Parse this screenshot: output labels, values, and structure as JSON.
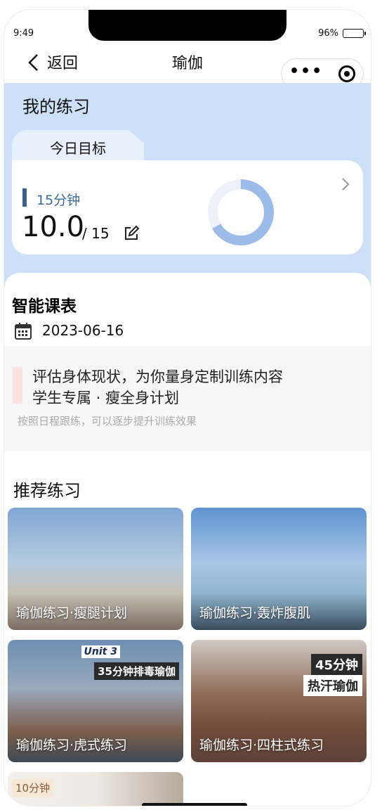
{
  "status_bar": {
    "time": "9:49",
    "battery": "96%"
  },
  "nav": {
    "back_label": "返回",
    "title": "瑜伽",
    "capsule_more": "•••"
  },
  "practice": {
    "title": "我的练习",
    "goal_tab": "今日目标",
    "duration": "15分钟",
    "value": "10.0",
    "total": "/ 15",
    "progress_fraction": 0.667,
    "colors": {
      "progress": "#9dbbe9",
      "track": "#edf1fa",
      "bar": "#3d5f8b"
    }
  },
  "schedule": {
    "title": "智能课表",
    "date": "2023-06-16",
    "plan_line1": "评估身体现状，为你量身定制训练内容",
    "plan_line2": "学生专属 · 瘦全身计划",
    "plan_hint": "按照日程跟练，可以逐步提升训练效果"
  },
  "recommend": {
    "title": "推荐练习",
    "items": [
      {
        "caption": "瑜伽练习·瘦腿计划"
      },
      {
        "caption": "瑜伽练习·轰炸腹肌"
      },
      {
        "caption": "瑜伽练习·虎式练习",
        "badge_unit": "Unit 3",
        "badge_main": "35分钟排毒瑜伽"
      },
      {
        "caption": "瑜伽练习·四柱式练习",
        "badge_main": "45分钟",
        "badge_sub": "热汗瑜伽"
      },
      {
        "caption": "",
        "badge_main": "10分钟"
      }
    ]
  }
}
